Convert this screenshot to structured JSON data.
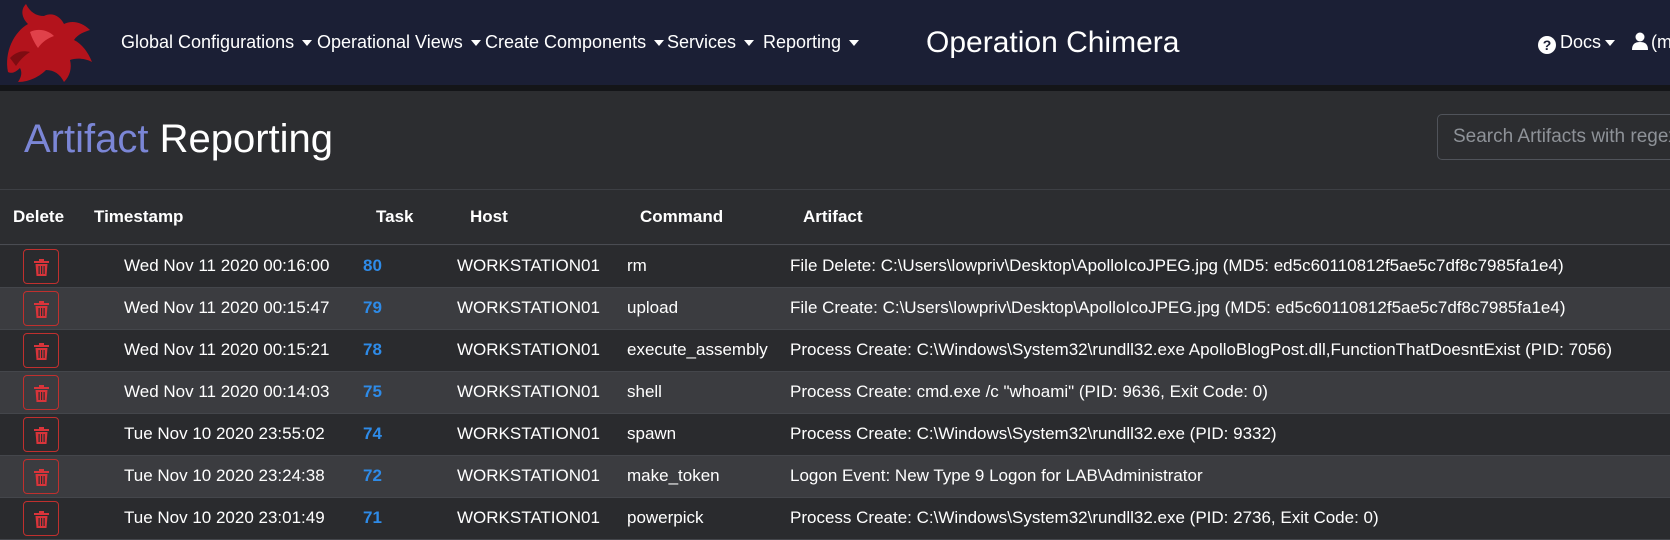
{
  "nav": {
    "menus": [
      "Global Configurations",
      "Operational Views",
      "Create Components",
      "Services",
      "Reporting"
    ],
    "brand": "Operation Chimera",
    "docs": "Docs",
    "user": "(m"
  },
  "page": {
    "title_accent": "Artifact",
    "title_rest": "Reporting",
    "search_placeholder": "Search Artifacts with regex"
  },
  "table": {
    "headers": [
      "Delete",
      "Timestamp",
      "Task",
      "Host",
      "Command",
      "Artifact"
    ],
    "rows": [
      {
        "timestamp": "Wed Nov 11 2020 00:16:00",
        "task": "80",
        "host": "WORKSTATION01",
        "command": "rm",
        "artifact": "File Delete: C:\\Users\\lowpriv\\Desktop\\ApolloIcoJPEG.jpg (MD5: ed5c60110812f5ae5c7df8c7985fa1e4)"
      },
      {
        "timestamp": "Wed Nov 11 2020 00:15:47",
        "task": "79",
        "host": "WORKSTATION01",
        "command": "upload",
        "artifact": "File Create: C:\\Users\\lowpriv\\Desktop\\ApolloIcoJPEG.jpg (MD5: ed5c60110812f5ae5c7df8c7985fa1e4)"
      },
      {
        "timestamp": "Wed Nov 11 2020 00:15:21",
        "task": "78",
        "host": "WORKSTATION01",
        "command": "execute_assembly",
        "artifact": "Process Create: C:\\Windows\\System32\\rundll32.exe ApolloBlogPost.dll,FunctionThatDoesntExist (PID: 7056)"
      },
      {
        "timestamp": "Wed Nov 11 2020 00:14:03",
        "task": "75",
        "host": "WORKSTATION01",
        "command": "shell",
        "artifact": "Process Create: cmd.exe /c \"whoami\" (PID: 9636, Exit Code: 0)"
      },
      {
        "timestamp": "Tue Nov 10 2020 23:55:02",
        "task": "74",
        "host": "WORKSTATION01",
        "command": "spawn",
        "artifact": "Process Create: C:\\Windows\\System32\\rundll32.exe (PID: 9332)"
      },
      {
        "timestamp": "Tue Nov 10 2020 23:24:38",
        "task": "72",
        "host": "WORKSTATION01",
        "command": "make_token",
        "artifact": "Logon Event: New Type 9 Logon for LAB\\Administrator"
      },
      {
        "timestamp": "Tue Nov 10 2020 23:01:49",
        "task": "71",
        "host": "WORKSTATION01",
        "command": "powerpick",
        "artifact": "Process Create: C:\\Windows\\System32\\rundll32.exe (PID: 2736, Exit Code: 0)"
      }
    ]
  },
  "colors": {
    "navbar": "#1b1f35",
    "accent": "#7b86d6",
    "task_link": "#2e8be8",
    "delete_red": "#c0302e"
  },
  "icons": [
    "chimera-logo",
    "question-circle-icon",
    "user-icon",
    "trash-icon",
    "caret-down-icon"
  ]
}
